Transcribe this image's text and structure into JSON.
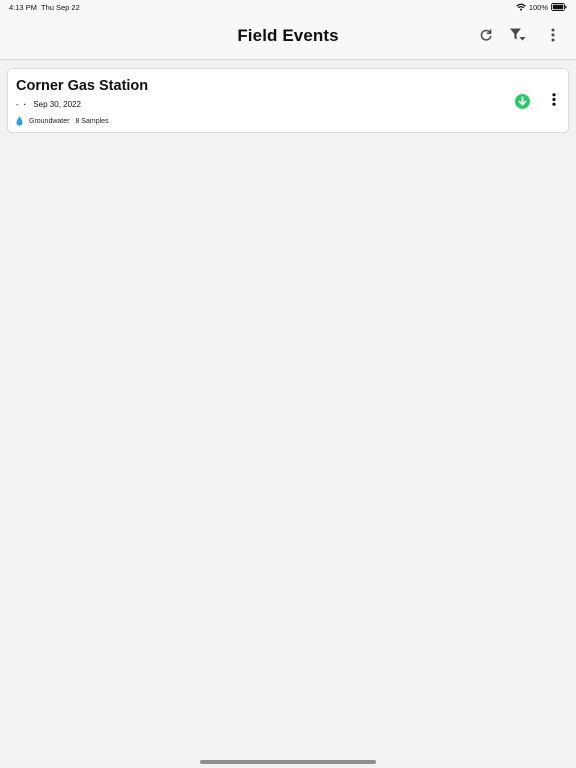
{
  "status_bar": {
    "time": "4:13 PM",
    "date": "Thu Sep 22",
    "battery": "100%"
  },
  "header": {
    "title": "Field Events",
    "icons": {
      "refresh": "refresh-icon",
      "filter": "filter-icon",
      "more": "more-vertical-icon"
    }
  },
  "events": [
    {
      "title": "Corner Gas Station",
      "prefix": "-",
      "date": "Sep 30, 2022",
      "media": "Groundwater",
      "samples": "8 Samples",
      "media_icon": "water-drop-icon",
      "download_icon": "download-icon"
    }
  ],
  "colors": {
    "background": "#f2f2f2",
    "card": "#ffffff",
    "accent_green": "#2ec76b",
    "water_blue": "#27a3e3",
    "icon_gray": "#4a4a4a"
  }
}
